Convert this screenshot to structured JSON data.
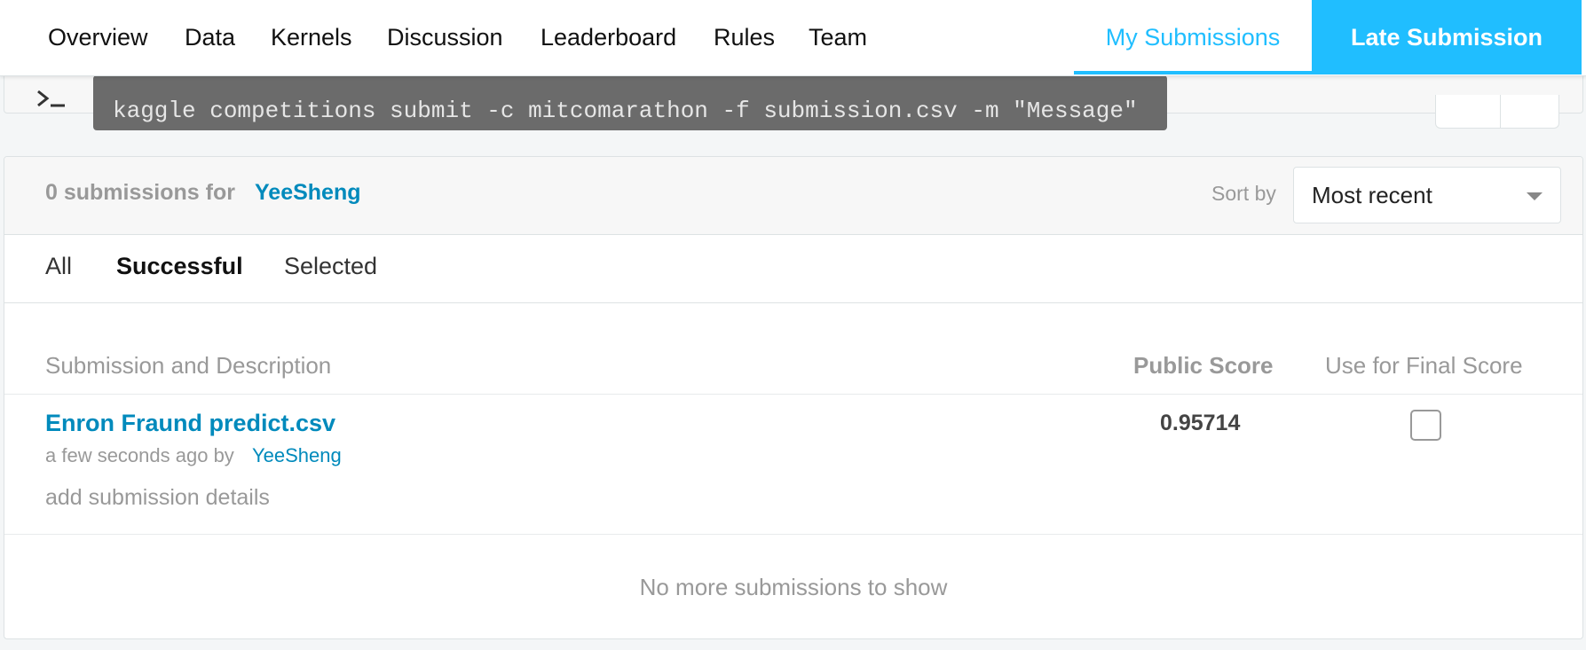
{
  "command": {
    "text": "kaggle competitions submit -c mitcomarathon -f submission.csv -m \"Message\""
  },
  "nav": {
    "links": [
      "Overview",
      "Data",
      "Kernels",
      "Discussion",
      "Leaderboard",
      "Rules",
      "Team"
    ],
    "my_submissions": "My Submissions",
    "late_submission": "Late Submission"
  },
  "submissions": {
    "count_text": "0 submissions for",
    "user": "YeeSheng",
    "sort_label": "Sort by",
    "sort_value": "Most recent",
    "tabs": [
      "All",
      "Successful",
      "Selected"
    ],
    "active_tab": "Successful",
    "columns": {
      "description": "Submission and Description",
      "public_score": "Public Score",
      "final_score": "Use for Final Score"
    },
    "rows": [
      {
        "title": "Enron Fraund predict.csv",
        "meta": "a few seconds ago by",
        "user": "YeeSheng",
        "details": "add submission details",
        "score": "0.95714",
        "selected": false
      }
    ],
    "footer": "No more submissions to show"
  },
  "colors": {
    "accent": "#20beff",
    "link": "#008abc",
    "muted": "#999999"
  }
}
